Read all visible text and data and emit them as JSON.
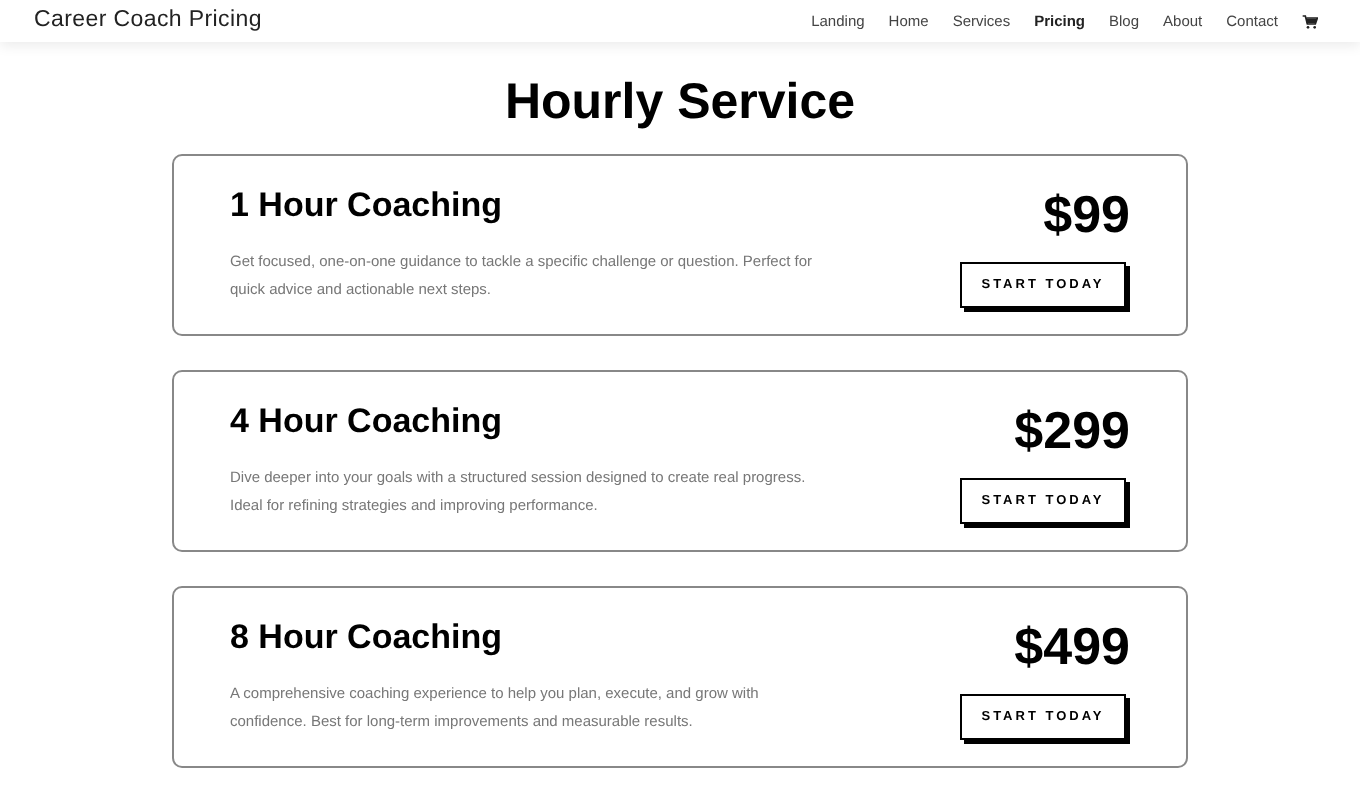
{
  "site_title": "Career Coach Pricing",
  "nav": [
    {
      "label": "Landing",
      "selected": false
    },
    {
      "label": "Home",
      "selected": false
    },
    {
      "label": "Services",
      "selected": false
    },
    {
      "label": "Pricing",
      "selected": true
    },
    {
      "label": "Blog",
      "selected": false
    },
    {
      "label": "About",
      "selected": false
    },
    {
      "label": "Contact",
      "selected": false
    }
  ],
  "heading": "Hourly Service",
  "plans": [
    {
      "title": "1 Hour Coaching",
      "price": "$99",
      "description": "Get focused, one-on-one guidance to tackle a specific challenge or question. Perfect for quick advice and actionable next steps.",
      "button": "START TODAY"
    },
    {
      "title": "4 Hour Coaching",
      "price": "$299",
      "description": "Dive deeper into your goals with a structured session designed to create real progress. Ideal for refining strategies and improving performance.",
      "button": "START TODAY"
    },
    {
      "title": "8 Hour Coaching",
      "price": "$499",
      "description": "A comprehensive coaching experience to help you plan, execute, and grow with confidence. Best for long-term improvements and measurable results.",
      "button": "START TODAY"
    }
  ]
}
